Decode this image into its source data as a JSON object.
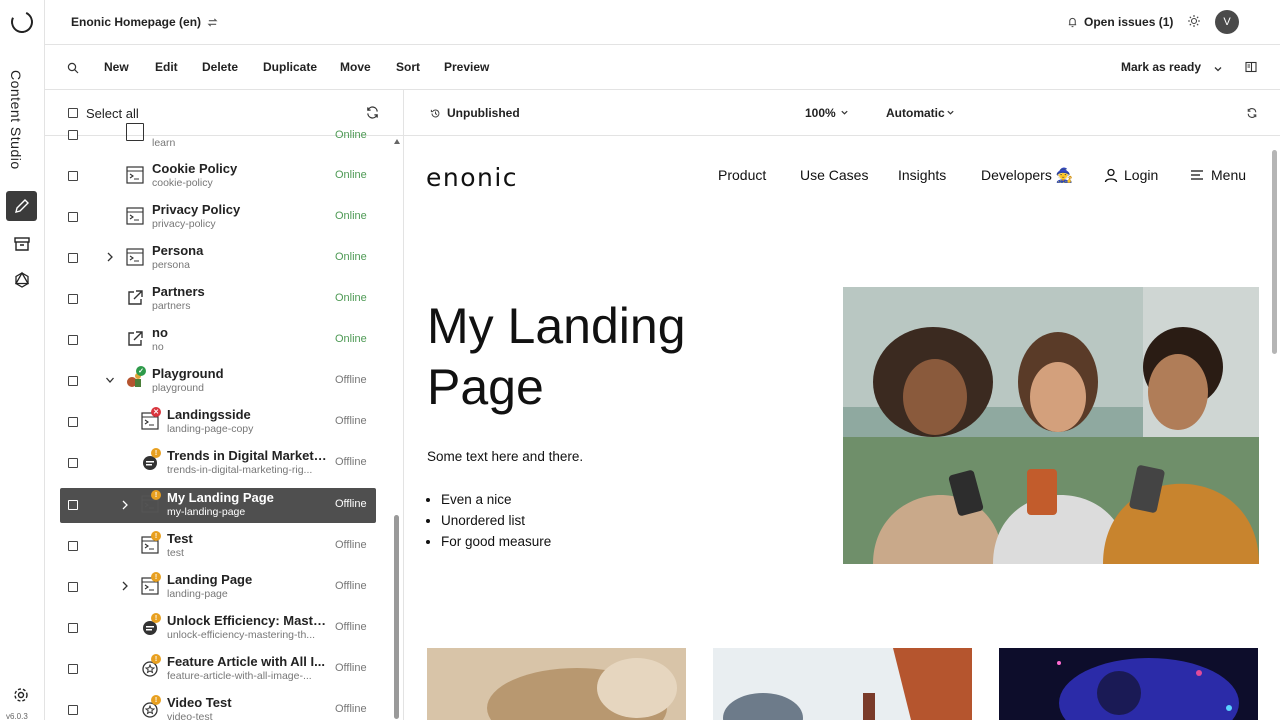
{
  "app": {
    "name": "Content Studio",
    "version": "v6.0.3"
  },
  "topbar": {
    "project": "Enonic Homepage (en)",
    "issues": "Open issues (1)",
    "avatar_initial": "V"
  },
  "toolbar": {
    "buttons": [
      "New",
      "Edit",
      "Delete",
      "Duplicate",
      "Move",
      "Sort",
      "Preview"
    ],
    "mark_ready": "Mark as ready"
  },
  "tree": {
    "select_all": "Select all",
    "partial_row": {
      "path": "learn",
      "status": "Online"
    },
    "items": [
      {
        "name": "Cookie Policy",
        "path": "cookie-policy",
        "status": "Online"
      },
      {
        "name": "Privacy Policy",
        "path": "privacy-policy",
        "status": "Online"
      },
      {
        "name": "Persona",
        "path": "persona",
        "status": "Online"
      },
      {
        "name": "Partners",
        "path": "partners",
        "status": "Online"
      },
      {
        "name": "no",
        "path": "no",
        "status": "Online"
      },
      {
        "name": "Playground",
        "path": "playground",
        "status": "Offline"
      },
      {
        "name": "Landingsside",
        "path": "landing-page-copy",
        "status": "Offline"
      },
      {
        "name": "Trends in Digital Marketi...",
        "path": "trends-in-digital-marketing-rig...",
        "status": "Offline"
      },
      {
        "name": "My Landing Page",
        "path": "my-landing-page",
        "status": "Offline"
      },
      {
        "name": "Test",
        "path": "test",
        "status": "Offline"
      },
      {
        "name": "Landing Page",
        "path": "landing-page",
        "status": "Offline"
      },
      {
        "name": "Unlock Efficiency: Master...",
        "path": "unlock-efficiency-mastering-th...",
        "status": "Offline"
      },
      {
        "name": "Feature Article with All I...",
        "path": "feature-article-with-all-image-...",
        "status": "Offline"
      },
      {
        "name": "Video Test",
        "path": "video-test",
        "status": "Offline"
      }
    ]
  },
  "preview_bar": {
    "status": "Unpublished",
    "zoom": "100%",
    "device": "Automatic"
  },
  "site": {
    "brand": "enonic",
    "nav": [
      "Product",
      "Use Cases",
      "Insights",
      "Developers"
    ],
    "developers_emoji": "🧙",
    "login": "Login",
    "menu": "Menu",
    "hero_title": "My Landing Page",
    "hero_text": "Some text here and there.",
    "list": [
      "Even a nice",
      "Unordered list",
      "For good measure"
    ]
  },
  "colors": {
    "online": "#4e9a55",
    "offline": "#777777",
    "selected_row": "#4f4f4f",
    "warning_badge": "#e8a020",
    "error_badge": "#d9363e"
  }
}
